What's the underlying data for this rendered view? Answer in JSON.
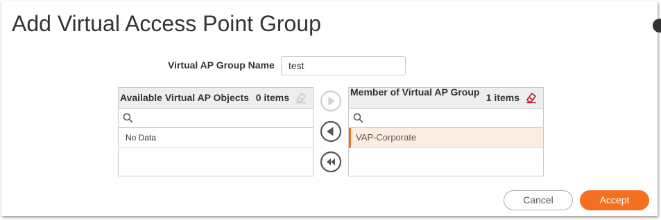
{
  "dialog": {
    "title": "Add Virtual Access Point Group"
  },
  "group_name": {
    "label": "Virtual AP Group Name",
    "value": "test"
  },
  "available_panel": {
    "title": "Available Virtual AP Objects",
    "count": "0 items",
    "search_placeholder": "",
    "rows": [
      "No Data"
    ]
  },
  "member_panel": {
    "title": "Member of Virtual AP Group",
    "count": "1 items",
    "search_placeholder": "",
    "rows": [
      "VAP-Corporate"
    ]
  },
  "transfer": {
    "move_right_icon": "play-circle-icon",
    "move_left_icon": "back-circle-icon",
    "move_all_left_icon": "rewind-circle-icon"
  },
  "footer": {
    "cancel_label": "Cancel",
    "accept_label": "Accept"
  },
  "colors": {
    "accent": "#f37021",
    "selected_row_bg": "#fcede3",
    "eraser_active": "#c8102e",
    "eraser_disabled": "#c8c8c8"
  }
}
